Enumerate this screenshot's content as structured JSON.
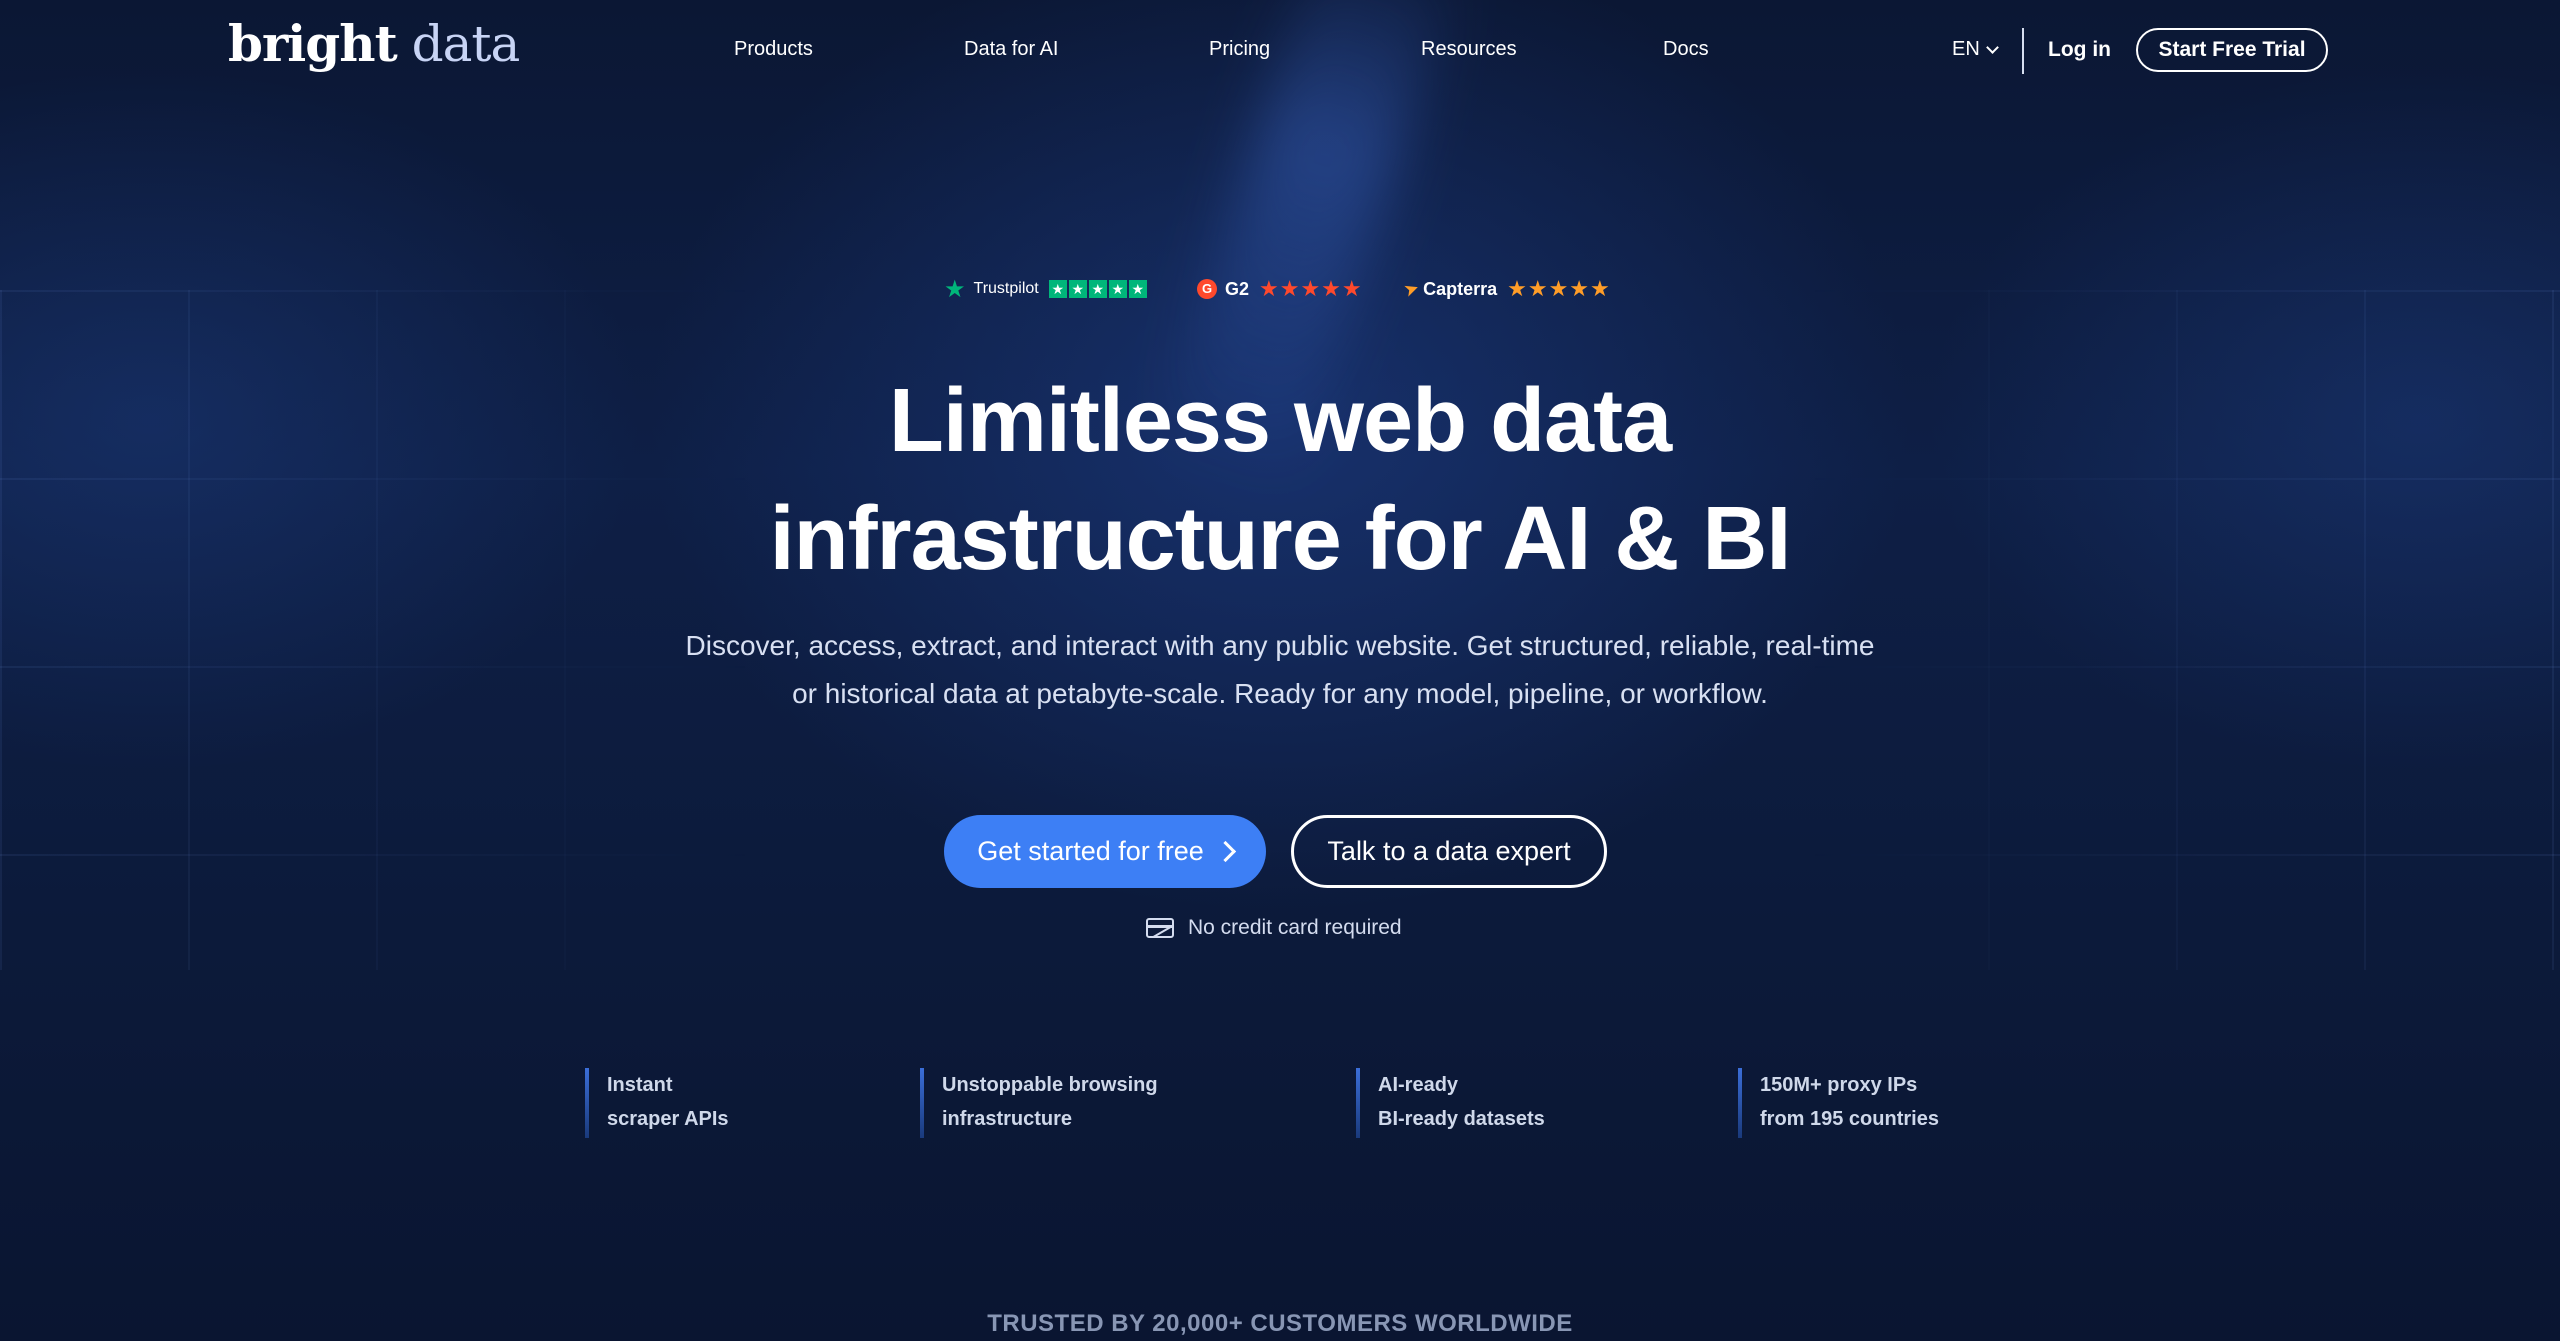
{
  "header": {
    "logo_primary": "bright",
    "logo_secondary": " data",
    "nav": [
      "Products",
      "Data for AI",
      "Pricing",
      "Resources",
      "Docs"
    ],
    "language": "EN",
    "login": "Log in",
    "cta": "Start Free Trial"
  },
  "ratings": {
    "trustpilot": {
      "label": "Trustpilot",
      "star_glyph": "★",
      "boxes": 5
    },
    "g2": {
      "badge": "G",
      "label": "G2",
      "stars": "★★★★★"
    },
    "capterra": {
      "label": "Capterra",
      "stars": "★★★★★"
    }
  },
  "hero": {
    "title_line1": "Limitless web data",
    "title_line2": "infrastructure for AI & BI",
    "subtitle_line1": "Discover, access, extract, and interact with any public website. Get structured, reliable, real-time",
    "subtitle_line2": "or historical data at petabyte-scale. Ready for any model, pipeline, or workflow.",
    "primary_cta": "Get started for free",
    "secondary_cta": "Talk to a data expert",
    "no_credit_card": "No credit card required"
  },
  "features": [
    {
      "line1": "Instant",
      "line2": "scraper APIs"
    },
    {
      "line1": "Unstoppable browsing",
      "line2": "infrastructure"
    },
    {
      "line1": "AI-ready",
      "line2": "BI-ready datasets"
    },
    {
      "line1": "150M+ proxy IPs",
      "line2": "from 195 countries"
    }
  ],
  "trusted_by": "TRUSTED BY 20,000+ CUSTOMERS WORLDWIDE",
  "colors": {
    "background": "#0c1936",
    "primary_button": "#3d7ff5",
    "trustpilot_green": "#00b67a",
    "g2_red": "#ff492c",
    "capterra_orange": "#ff9d28"
  }
}
